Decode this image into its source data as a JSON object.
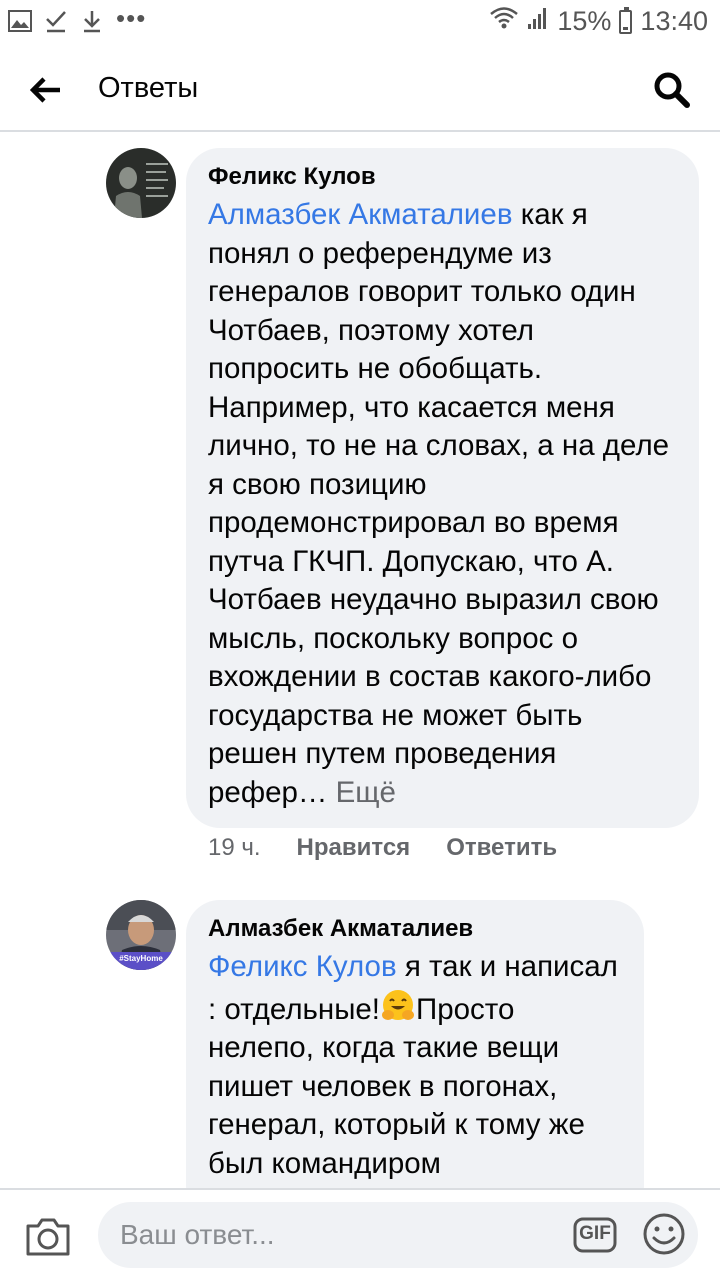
{
  "status_bar": {
    "dots": "•••",
    "battery": "15%",
    "time": "13:40"
  },
  "header": {
    "title": "Ответы"
  },
  "comments": [
    {
      "author": "Феликс Кулов",
      "mention": "Алмазбек Акматалиев",
      "text": " как я понял о референдуме из генералов говорит только один Чотбаев, поэтому хотел попросить не обобщать. Например, что касается меня лично, то не на словах, а на деле я свою позицию продемонстрировал во время путча ГКЧП. Допускаю, что А. Чотбаев неудачно выразил свою мысль, поскольку вопрос о вхождении в состав какого-либо государства  не может быть решен путем проведения рефер… ",
      "more": "Ещё",
      "time": "19 ч.",
      "like": "Нравится",
      "reply": "Ответить"
    },
    {
      "author": "Алмазбек Акматалиев",
      "mention": "Феликс Кулов",
      "text_before_emoji": " я так и написал : отдельные!",
      "text_after_emoji": "Просто нелепо, когда такие вещи пишет человек в погонах, генерал, который к тому же был командиром",
      "emoji": "hugging-face-emoji",
      "avatar_badge": "#StayHome"
    }
  ],
  "composer": {
    "placeholder": "Ваш ответ...",
    "gif_label": "GIF"
  },
  "icons": {
    "back": "arrow-left-icon",
    "search": "search-icon",
    "camera": "camera-icon",
    "gif": "gif-icon",
    "emoji": "smiley-icon"
  },
  "colors": {
    "mention": "#3578e5",
    "bubble": "#f0f2f5",
    "meta": "#65676b"
  }
}
